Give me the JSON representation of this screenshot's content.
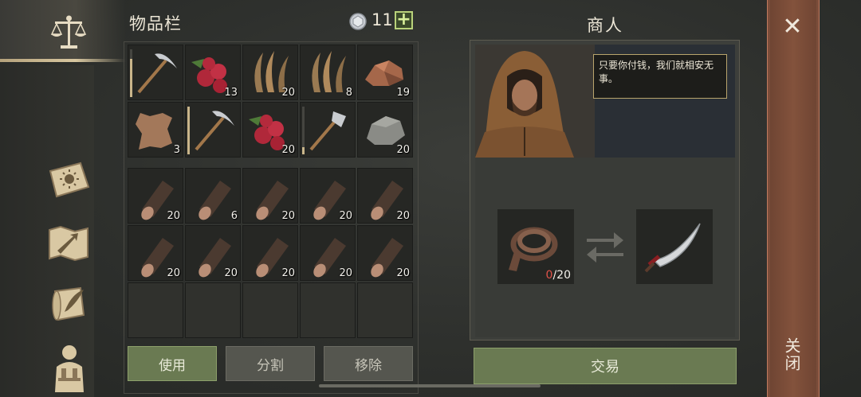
{
  "sidebar": {
    "icons": [
      "scales-icon",
      "journal-sun-icon",
      "map-icon",
      "scroll-quill-icon",
      "character-icon"
    ]
  },
  "inventory": {
    "title": "物品栏",
    "currency_count": "11",
    "plus_label": "+",
    "top_rows": [
      {
        "item": "pickaxe",
        "count": "",
        "durability": 0.8
      },
      {
        "item": "berries",
        "count": "13"
      },
      {
        "item": "fiber",
        "count": "20"
      },
      {
        "item": "fiber",
        "count": "8"
      },
      {
        "item": "copper-ore",
        "count": "19"
      },
      {
        "item": "leather",
        "count": "3"
      },
      {
        "item": "pickaxe",
        "count": "",
        "durability": 1.0
      },
      {
        "item": "berries",
        "count": "20"
      },
      {
        "item": "hatchet",
        "count": "",
        "durability": 0.15
      },
      {
        "item": "stone",
        "count": "20"
      }
    ],
    "log_rows": [
      {
        "item": "log",
        "count": "20"
      },
      {
        "item": "log",
        "count": "6"
      },
      {
        "item": "log",
        "count": "20"
      },
      {
        "item": "log",
        "count": "20"
      },
      {
        "item": "log",
        "count": "20"
      },
      {
        "item": "log",
        "count": "20"
      },
      {
        "item": "log",
        "count": "20"
      },
      {
        "item": "log",
        "count": "20"
      },
      {
        "item": "log",
        "count": "20"
      },
      {
        "item": "log",
        "count": "20"
      }
    ],
    "buttons": {
      "use": "使用",
      "split": "分割",
      "remove": "移除"
    }
  },
  "merchant": {
    "title": "商人",
    "speech": "只要你付钱，我们就相安无事。",
    "give": {
      "item": "leather-strap",
      "have": "0",
      "need": "/20"
    },
    "receive": {
      "item": "sabre"
    },
    "trade_label": "交易"
  },
  "close": {
    "label": "关闭",
    "x": "✕"
  },
  "colors": {
    "accent_green": "#6a7a52",
    "close_panel": "#7b4d3a",
    "need_red": "#e2534a"
  }
}
